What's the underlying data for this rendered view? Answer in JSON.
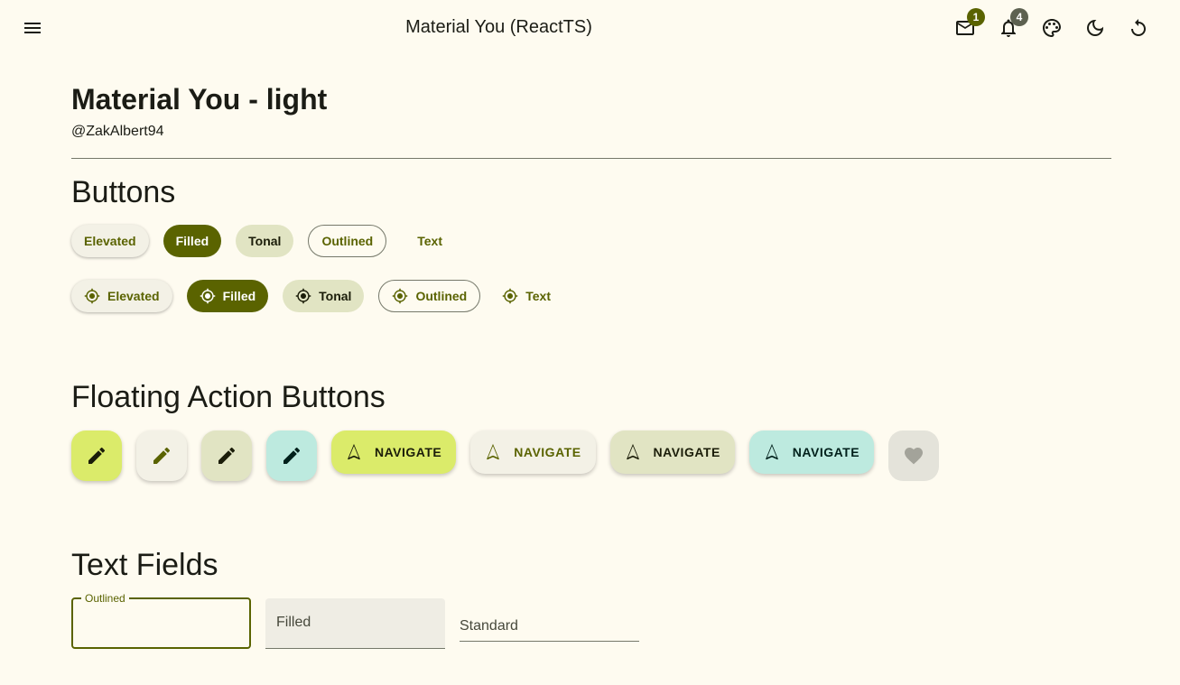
{
  "appbar": {
    "title": "Material You (ReactTS)",
    "menu_icon": "menu-icon",
    "mail_badge": "1",
    "notifications_badge": "4",
    "icons": [
      "mail-icon",
      "bell-icon",
      "palette-icon",
      "moon-icon",
      "refresh-icon"
    ]
  },
  "header": {
    "title": "Material You - light",
    "subtitle": "@ZakAlbert94"
  },
  "buttons": {
    "section_title": "Buttons",
    "row1": [
      "Elevated",
      "Filled",
      "Tonal",
      "Outlined",
      "Text"
    ],
    "row2": [
      "Elevated",
      "Filled",
      "Tonal",
      "Outlined",
      "Text"
    ],
    "row2_icon": "gps-fixed-icon"
  },
  "fabs": {
    "section_title": "Floating Action Buttons",
    "fab_icon": "pencil-icon",
    "extended_label": "NAVIGATE",
    "extended_labels": [
      "NAVIGATE",
      "NAVIGATE",
      "NAVIGATE",
      "NAVIGATE"
    ],
    "extended_icon": "navigation-icon",
    "disabled_icon": "heart-icon"
  },
  "text_fields": {
    "section_title": "Text Fields",
    "outlined_label": "Outlined",
    "filled_label": "Filled",
    "standard_label": "Standard"
  },
  "colors": {
    "background": "#fefbf0",
    "primary": "#5a6300",
    "primary_container": "#dbeb6a",
    "secondary_container": "#e1e4c3",
    "tertiary_container": "#bdeadf"
  }
}
